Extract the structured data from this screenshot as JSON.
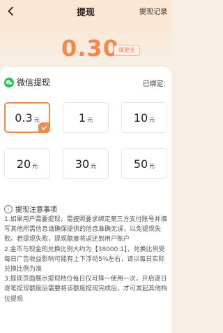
{
  "header": {
    "title": "提现",
    "history_label": "提现记录"
  },
  "balance": {
    "amount": "0.30",
    "earn_more_label": "赚更多"
  },
  "method": {
    "label": "微信提现",
    "bind_status": "已绑定:"
  },
  "options": [
    {
      "value": "0.3",
      "unit": "元",
      "selected": true
    },
    {
      "value": "1",
      "unit": "元",
      "selected": false
    },
    {
      "value": "10",
      "unit": "元",
      "selected": false
    },
    {
      "value": "20",
      "unit": "元",
      "selected": false
    },
    {
      "value": "30",
      "unit": "元",
      "selected": false
    },
    {
      "value": "50",
      "unit": "元",
      "selected": false
    }
  ],
  "notes": {
    "title": "提现注意事项",
    "items": [
      "1.如果用户需要提现，需按照要求绑定第三方支付账号并填写其他所需信息请确保提供的信息准确无误，以免提现失败。若提现失败，提现额度将返还到用户账户",
      "2.金币与现金的兑换比例大约为【38000:1】，兑换比例受每日广告收益影响可能有上下浮动5%左右，请以每日实际兑换比例为准",
      "3.提现页面展示提现档位每日仅可择一使用一次，开启逐日逐笔提现额度后需要将该额度提现完成后，才可发起其他档位提现"
    ]
  },
  "colors": {
    "accent": "#f08a4b",
    "wechat": "#23c24b"
  }
}
